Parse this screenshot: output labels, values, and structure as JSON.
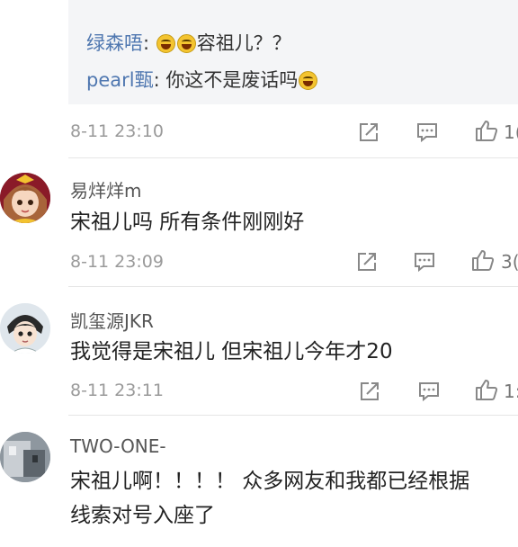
{
  "reply_box": {
    "line1": {
      "name": "绿森唔",
      "sep": ": ",
      "text": "容祖儿？？",
      "emoji_count": 2
    },
    "line2": {
      "name": "pearl甄",
      "sep": ": ",
      "text": "你这不是废话吗",
      "emoji_count": 1
    }
  },
  "top_comment_meta": {
    "time": "8-11 23:10",
    "like_count": "1("
  },
  "comments": [
    {
      "username": "易烊烊m",
      "body": "宋祖儿吗 所有条件刚刚好",
      "time": "8-11 23:09",
      "like_count": "3("
    },
    {
      "username": "凯玺源JKR",
      "body": "我觉得是宋祖儿    但宋祖儿今年才20",
      "time": "8-11 23:11",
      "like_count": "1:"
    },
    {
      "username": "TWO-ONE-",
      "body_line1": "宋祖儿啊！！！！ 众多网友和我都已经根据",
      "body_line2": "线索对号入座了"
    }
  ],
  "icons": {
    "share": "share-icon",
    "comment": "comment-icon",
    "like": "thumbs-up-icon",
    "emoji": "laughing-tears-emoji-icon"
  },
  "colors": {
    "username_link": "#4f77b0",
    "meta_gray": "#9a9a9a",
    "reply_bg": "#f4f5f7"
  }
}
